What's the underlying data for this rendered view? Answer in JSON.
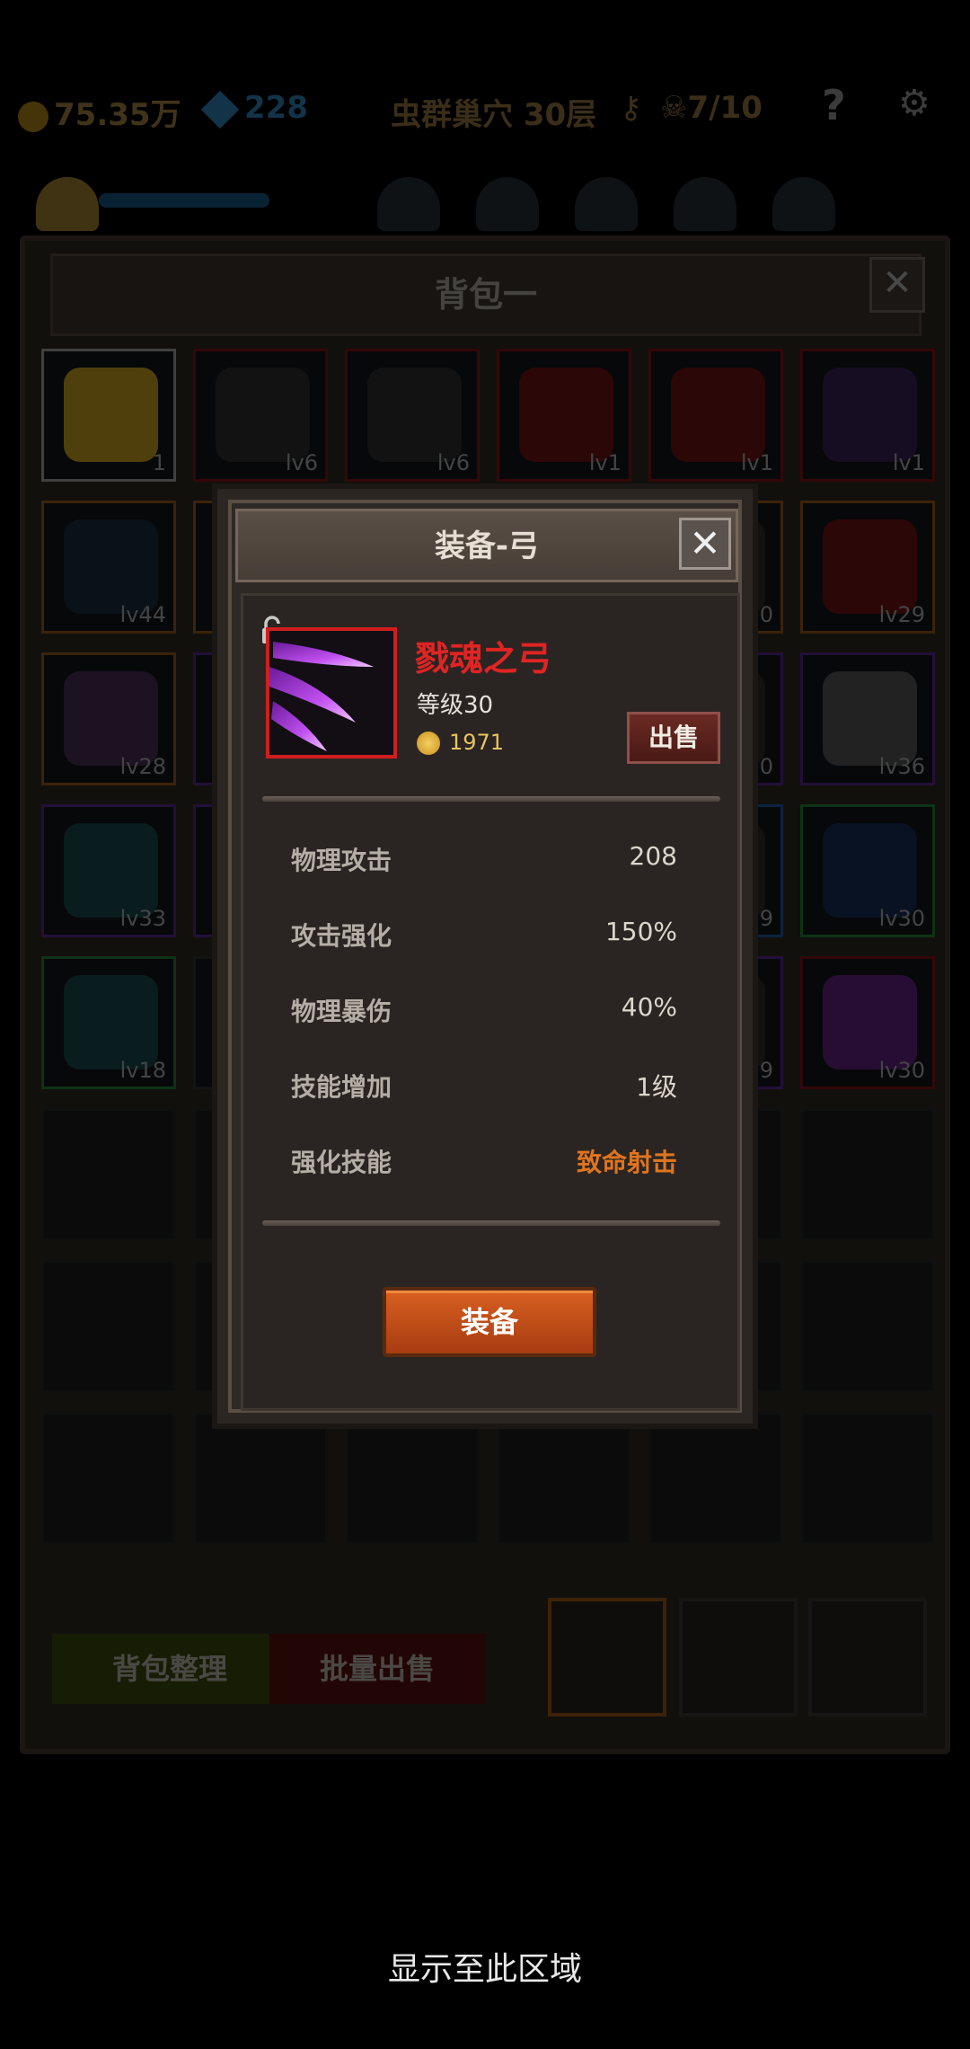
{
  "topbar": {
    "gold": "75.35万",
    "gems": "228",
    "stage": "虫群巢穴 30层",
    "keys": "7/10",
    "help": "?"
  },
  "bag": {
    "title": "背包一",
    "close": "✕",
    "items": [
      {
        "label": "1",
        "color": "#f2c22a",
        "border": "#c8c8c8"
      },
      {
        "label": "lv6",
        "color": "#3a3a3e",
        "border": "#a01c1c"
      },
      {
        "label": "lv6",
        "color": "#3a3a3e",
        "border": "#a01c1c"
      },
      {
        "label": "lv1",
        "color": "#8a1a1a",
        "border": "#a01c1c"
      },
      {
        "label": "lv1",
        "color": "#8a1a1a",
        "border": "#a01c1c"
      },
      {
        "label": "lv1",
        "color": "#4a2a6a",
        "border": "#a01c1c"
      },
      {
        "label": "lv44",
        "color": "#1e3550",
        "border": "#b8701e"
      },
      {
        "label": "",
        "color": "#3a3a3a",
        "border": "#b8701e"
      },
      {
        "label": "",
        "color": "#3a3a3a",
        "border": "#b8701e"
      },
      {
        "label": "",
        "color": "#3a3a3a",
        "border": "#b8701e"
      },
      {
        "label": "0",
        "color": "#3a3a3a",
        "border": "#b8701e"
      },
      {
        "label": "lv29",
        "color": "#8a1a1a",
        "border": "#b8701e"
      },
      {
        "label": "lv28",
        "color": "#5a3a6a",
        "border": "#b8701e"
      },
      {
        "label": "",
        "color": "#3a3a3a",
        "border": "#7030b0"
      },
      {
        "label": "",
        "color": "#3a3a3a",
        "border": "#7030b0"
      },
      {
        "label": "",
        "color": "#3a3a3a",
        "border": "#7030b0"
      },
      {
        "label": "0",
        "color": "#3a3a3a",
        "border": "#7030b0"
      },
      {
        "label": "lv36",
        "color": "#6a6a70",
        "border": "#7030b0"
      },
      {
        "label": "lv33",
        "color": "#1e5a60",
        "border": "#7030b0"
      },
      {
        "label": "",
        "color": "#3a3a3a",
        "border": "#7030b0"
      },
      {
        "label": "",
        "color": "#3a3a3a",
        "border": "#7030b0"
      },
      {
        "label": "",
        "color": "#3a3a3a",
        "border": "#7030b0"
      },
      {
        "label": "9",
        "color": "#3a3a3a",
        "border": "#2a70c0"
      },
      {
        "label": "lv30",
        "color": "#1e3a70",
        "border": "#2aa040"
      },
      {
        "label": "lv18",
        "color": "#1e5a60",
        "border": "#2aa040"
      },
      {
        "label": "",
        "color": "#3a3a3a",
        "border": "#3a3f40"
      },
      {
        "label": "",
        "color": "#3a3a3a",
        "border": "#3a3f40"
      },
      {
        "label": "",
        "color": "#3a3a3a",
        "border": "#3a3f40"
      },
      {
        "label": "9",
        "color": "#3a3a3a",
        "border": "#7030b0"
      },
      {
        "label": "lv30",
        "color": "#7a2aa0",
        "border": "#a01c1c"
      }
    ],
    "sort_label": "背包整理",
    "batch_sell_label": "批量出售"
  },
  "dialog": {
    "title": "装备-弓",
    "close": "✕",
    "item_name": "戮魂之弓",
    "level": "等级30",
    "price": "1971",
    "sell_label": "出售",
    "stats": [
      {
        "key": "物理攻击",
        "value": "208"
      },
      {
        "key": "攻击强化",
        "value": "150%"
      },
      {
        "key": "物理暴伤",
        "value": "40%"
      },
      {
        "key": "技能增加",
        "value": "1级"
      },
      {
        "key": "强化技能",
        "value": "致命射击"
      }
    ],
    "equip_label": "装备"
  },
  "hint": "显示至此区域",
  "colors": {
    "item_name": "#e02424",
    "skill": "#e0741f",
    "equip_button": "#c8501a"
  }
}
